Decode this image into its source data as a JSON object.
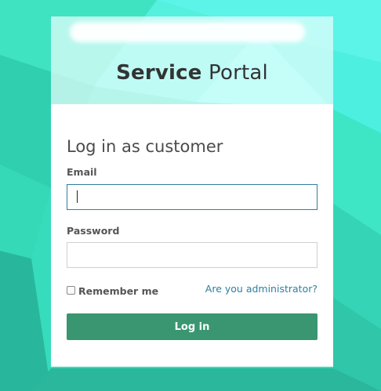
{
  "portal": {
    "title_strong": "Service",
    "title_light": "Portal"
  },
  "form": {
    "heading": "Log in as customer",
    "email_label": "Email",
    "email_value": "",
    "password_label": "Password",
    "password_value": "",
    "remember_label": "Remember me",
    "remember_checked": false,
    "admin_link": "Are you administrator?",
    "submit_label": "Log in"
  },
  "colors": {
    "background": "#3ee0bf",
    "button": "#3a9670",
    "link": "#2f7fa0",
    "focus_border": "#2f7fa0"
  }
}
